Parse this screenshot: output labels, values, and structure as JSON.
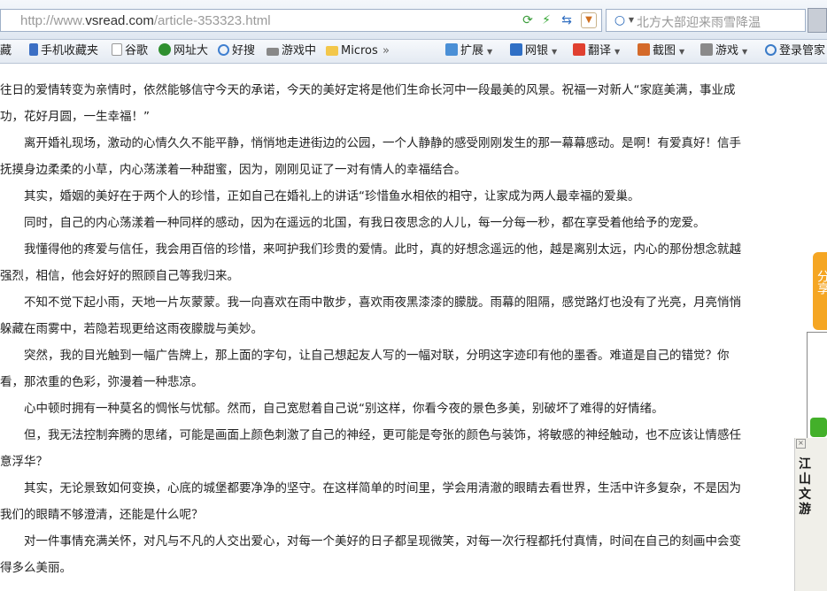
{
  "address_bar": {
    "url_prefix": "http://www.",
    "url_domain": "vsread.com",
    "url_path": "/article-353323.html",
    "search_placeholder": "北方大部迎来雨雪降温"
  },
  "bookmarks": [
    {
      "label": "藏",
      "icon": "folder-icon"
    },
    {
      "label": "手机收藏夹",
      "icon": "phone-icon"
    },
    {
      "label": "谷歌",
      "icon": "page-icon"
    },
    {
      "label": "网址大",
      "icon": "globe-icon"
    },
    {
      "label": "好搜",
      "icon": "search-icon"
    },
    {
      "label": "游戏中",
      "icon": "gamepad-icon"
    },
    {
      "label": "Micros",
      "icon": "folder-icon"
    },
    {
      "label": "扩展",
      "icon": "grid-icon"
    },
    {
      "label": "网银",
      "icon": "shield-icon"
    },
    {
      "label": "翻译",
      "icon": "translate-icon"
    },
    {
      "label": "截图",
      "icon": "scissors-icon"
    },
    {
      "label": "游戏",
      "icon": "gamepad-icon"
    },
    {
      "label": "登录管家",
      "icon": "key-icon"
    }
  ],
  "overflow_glyph": "»",
  "article_lines": [
    "往日的爱情转变为亲情时，依然能够信守今天的承诺，今天的美好定将是他们生命长河中一段最美的风景。祝福一对新人“家庭美满，事业成",
    "功，花好月圆，一生幸福！”",
    "　　离开婚礼现场，激动的心情久久不能平静，悄悄地走进街边的公园，一个人静静的感受刚刚发生的那一幕幕感动。是啊！有爱真好！信手",
    "抚摸身边柔柔的小草，内心荡漾着一种甜蜜，因为，刚刚见证了一对有情人的幸福结合。",
    "　　其实，婚姻的美好在于两个人的珍惜，正如自己在婚礼上的讲话“珍惜鱼水相依的相守，让家成为两人最幸福的爱巢。",
    "　　同时，自己的内心荡漾着一种同样的感动，因为在遥远的北国，有我日夜思念的人儿，每一分每一秒，都在享受着他给予的宠爱。",
    "　　我懂得他的疼爱与信任，我会用百倍的珍惜，来呵护我们珍贵的爱情。此时，真的好想念遥远的他，越是离别太远，内心的那份想念就越",
    "强烈，相信，他会好好的照顾自己等我归来。",
    "　　不知不觉下起小雨，天地一片灰蒙蒙。我一向喜欢在雨中散步，喜欢雨夜黑漆漆的朦胧。雨幕的阻隔，感觉路灯也没有了光亮，月亮悄悄",
    "躲藏在雨雾中，若隐若现更给这雨夜朦胧与美妙。",
    "　　突然，我的目光触到一幅广告牌上，那上面的字句，让自己想起友人写的一幅对联，分明这字迹印有他的墨香。难道是自己的错觉？你",
    "看，那浓重的色彩，弥漫着一种悲凉。",
    "　　心中顿时拥有一种莫名的惆怅与忧郁。然而，自己宽慰着自己说“别这样，你看今夜的景色多美，别破坏了难得的好情绪。",
    "　　但，我无法控制奔腾的思绪，可能是画面上颜色刺激了自己的神经，更可能是夸张的颜色与装饰，将敏感的神经触动，也不应该让情感任",
    "意浮华？",
    "　　其实，无论景致如何变换，心底的城堡都要净净的坚守。在这样简单的时间里，学会用清澈的眼睛去看世界，生活中许多复杂，不是因为",
    "我们的眼睛不够澄清，还能是什么呢？",
    "　　对一件事情充满关怀，对凡与不凡的人交出爱心，对每一个美好的日子都呈现微笑，对每一次行程都托付真情，时间在自己的刻画中会变",
    "得多么美丽。"
  ],
  "side_tab": {
    "label": "分享"
  },
  "side_banner": {
    "title": "江山文游"
  }
}
